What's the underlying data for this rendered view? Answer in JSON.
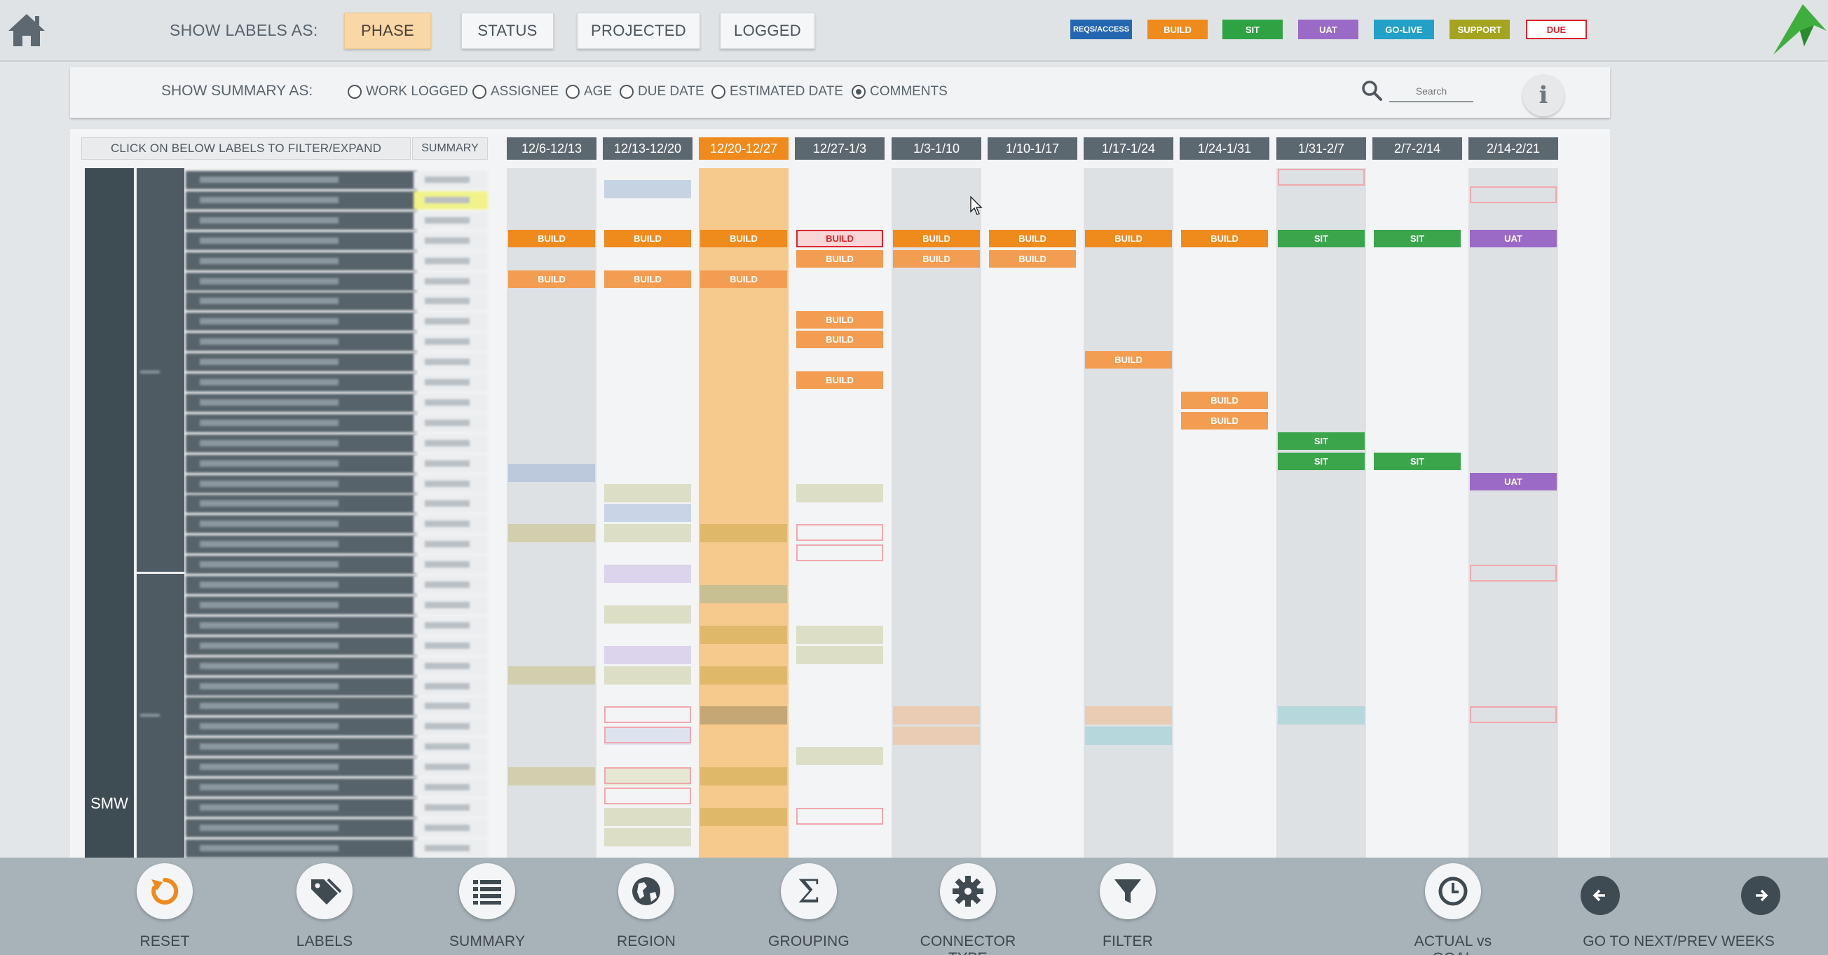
{
  "header": {
    "show_labels_caption": "SHOW LABELS AS:",
    "modes": [
      {
        "label": "PHASE",
        "active": true
      },
      {
        "label": "STATUS",
        "active": false
      },
      {
        "label": "PROJECTED",
        "active": false
      },
      {
        "label": "LOGGED",
        "active": false
      }
    ],
    "legend": [
      {
        "label": "REQS/ACCESS",
        "color": "#2466b0"
      },
      {
        "label": "BUILD",
        "color": "#ef8a1d"
      },
      {
        "label": "SIT",
        "color": "#2fa244"
      },
      {
        "label": "UAT",
        "color": "#9b6ac6"
      },
      {
        "label": "GO-LIVE",
        "color": "#22a0c7"
      },
      {
        "label": "SUPPORT",
        "color": "#a4a421"
      },
      {
        "label": "DUE",
        "color": "#d9242f"
      }
    ]
  },
  "summary_bar": {
    "caption": "SHOW SUMMARY AS:",
    "options": [
      {
        "label": "WORK LOGGED",
        "selected": false
      },
      {
        "label": "ASSIGNEE",
        "selected": false
      },
      {
        "label": "AGE",
        "selected": false
      },
      {
        "label": "DUE DATE",
        "selected": false
      },
      {
        "label": "ESTIMATED DATE",
        "selected": false
      },
      {
        "label": "COMMENTS",
        "selected": true
      }
    ],
    "search_placeholder": "Search",
    "info_label": "i"
  },
  "grid": {
    "filter_header": "CLICK ON BELOW LABELS TO FILTER/EXPAND",
    "summary_header": "SUMMARY",
    "weeks": [
      "12/6-12/13",
      "12/13-12/20",
      "12/20-12/27",
      "12/27-1/3",
      "1/3-1/10",
      "1/10-1/17",
      "1/17-1/24",
      "1/24-1/31",
      "1/31-2/7",
      "2/7-2/14",
      "2/14-2/21"
    ],
    "current_week_index": 2,
    "group_label": "SMW",
    "bar_labels": {
      "build": "BUILD",
      "sit": "SIT",
      "uat": "UAT"
    }
  },
  "toolbar": {
    "tools": [
      {
        "label": "RESET",
        "icon": "reset-icon"
      },
      {
        "label": "LABELS",
        "icon": "tag-icon"
      },
      {
        "label": "SUMMARY",
        "icon": "list-icon"
      },
      {
        "label": "REGION",
        "icon": "globe-icon"
      },
      {
        "label": "GROUPING",
        "icon": "sigma-icon"
      },
      {
        "label": "CONNECTOR TYPE",
        "icon": "gear-icon"
      },
      {
        "label": "FILTER",
        "icon": "filter-icon"
      },
      {
        "label": "ACTUAL vs GOAL",
        "icon": "clock-icon"
      }
    ],
    "nav_label": "GO TO NEXT/PREV WEEKS"
  }
}
